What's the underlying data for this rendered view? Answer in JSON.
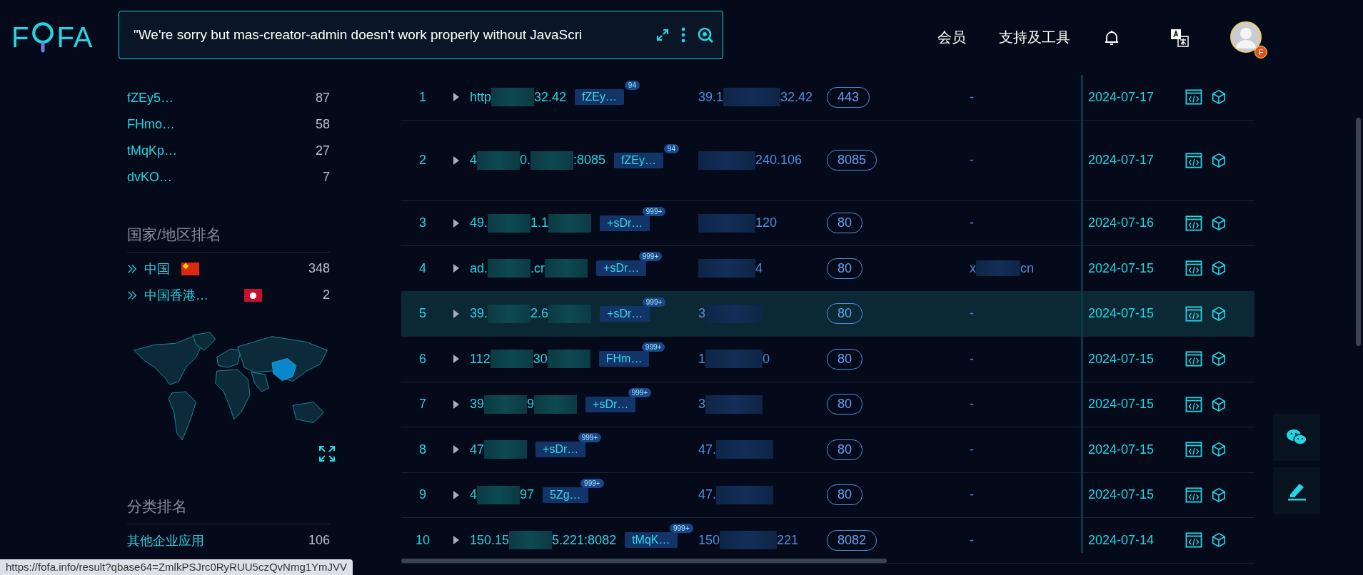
{
  "header": {
    "logo": {
      "before": "F",
      "after": "FA"
    },
    "search": {
      "value": "\"We're sorry but mas-creator-admin doesn't work properly without JavaScri"
    },
    "nav": [
      "会员",
      "支持及工具"
    ],
    "avatar_badge": "F"
  },
  "sidebar": {
    "top_items": [
      {
        "label": "fZEy5…",
        "count": "87"
      },
      {
        "label": "FHmo…",
        "count": "58"
      },
      {
        "label": "tMqKp…",
        "count": "27"
      },
      {
        "label": "dvKO…",
        "count": "7"
      }
    ],
    "country_title": "国家/地区排名",
    "countries": [
      {
        "label": "中国",
        "kind": "cn",
        "count": "348"
      },
      {
        "label": "中国香港…",
        "kind": "hk",
        "count": "2"
      }
    ],
    "category_title": "分类排名",
    "categories": [
      {
        "label": "其他企业应用",
        "count": "106"
      }
    ]
  },
  "rows": [
    {
      "num": "1",
      "host": [
        {
          "kind": "text",
          "text": "http"
        },
        {
          "kind": "blur"
        },
        {
          "kind": "text",
          "text": "32.42"
        }
      ],
      "tag": "fZEy…",
      "tag_count": "94",
      "ip": [
        {
          "kind": "text",
          "text": "39.1"
        },
        {
          "kind": "blur"
        },
        {
          "kind": "text",
          "text": "32.42"
        }
      ],
      "port": "443",
      "domain": [
        {
          "kind": "text",
          "text": "-"
        }
      ],
      "date": "2024-07-17",
      "selected": false,
      "tall": false
    },
    {
      "num": "2",
      "host": [
        {
          "kind": "text",
          "text": "4"
        },
        {
          "kind": "blur"
        },
        {
          "kind": "text",
          "text": "0."
        },
        {
          "kind": "blur"
        },
        {
          "kind": "text",
          "text": ":8085"
        }
      ],
      "tag": "fZEy…",
      "tag_count": "94",
      "ip": [
        {
          "kind": "blur"
        },
        {
          "kind": "text",
          "text": "240.106"
        }
      ],
      "port": "8085",
      "domain": [
        {
          "kind": "text",
          "text": "-"
        }
      ],
      "date": "2024-07-17",
      "selected": false,
      "tall": true
    },
    {
      "num": "3",
      "host": [
        {
          "kind": "text",
          "text": "49."
        },
        {
          "kind": "blur"
        },
        {
          "kind": "text",
          "text": "1.1"
        },
        {
          "kind": "blur"
        }
      ],
      "tag": "+sDr…",
      "tag_count": "999+",
      "ip": [
        {
          "kind": "blur"
        },
        {
          "kind": "text",
          "text": "120"
        }
      ],
      "port": "80",
      "domain": [
        {
          "kind": "text",
          "text": "-"
        }
      ],
      "date": "2024-07-16",
      "selected": false,
      "tall": false
    },
    {
      "num": "4",
      "host": [
        {
          "kind": "text",
          "text": "ad."
        },
        {
          "kind": "blur"
        },
        {
          "kind": "text",
          "text": ".cr"
        },
        {
          "kind": "blur"
        }
      ],
      "tag": "+sDr…",
      "tag_count": "999+",
      "ip": [
        {
          "kind": "blur"
        },
        {
          "kind": "text",
          "text": "4"
        }
      ],
      "port": "80",
      "domain": [
        {
          "kind": "text",
          "text": "x"
        },
        {
          "kind": "blur"
        },
        {
          "kind": "text",
          "text": "cn"
        }
      ],
      "date": "2024-07-15",
      "selected": false,
      "tall": false
    },
    {
      "num": "5",
      "host": [
        {
          "kind": "text",
          "text": "39."
        },
        {
          "kind": "blur"
        },
        {
          "kind": "text",
          "text": "2.6"
        },
        {
          "kind": "blur"
        }
      ],
      "tag": "+sDr…",
      "tag_count": "999+",
      "ip": [
        {
          "kind": "text",
          "text": "3"
        },
        {
          "kind": "blur"
        }
      ],
      "port": "80",
      "domain": [
        {
          "kind": "text",
          "text": "-"
        }
      ],
      "date": "2024-07-15",
      "selected": true,
      "tall": false
    },
    {
      "num": "6",
      "host": [
        {
          "kind": "text",
          "text": "112"
        },
        {
          "kind": "blur"
        },
        {
          "kind": "text",
          "text": "30"
        },
        {
          "kind": "blur"
        }
      ],
      "tag": "FHm…",
      "tag_count": "999+",
      "ip": [
        {
          "kind": "text",
          "text": "1"
        },
        {
          "kind": "blur"
        },
        {
          "kind": "text",
          "text": "0"
        }
      ],
      "port": "80",
      "domain": [
        {
          "kind": "text",
          "text": "-"
        }
      ],
      "date": "2024-07-15",
      "selected": false,
      "tall": false
    },
    {
      "num": "7",
      "host": [
        {
          "kind": "text",
          "text": "39"
        },
        {
          "kind": "blur"
        },
        {
          "kind": "text",
          "text": "9"
        },
        {
          "kind": "blur"
        }
      ],
      "tag": "+sDr…",
      "tag_count": "999+",
      "ip": [
        {
          "kind": "text",
          "text": "3"
        },
        {
          "kind": "blur"
        }
      ],
      "port": "80",
      "domain": [
        {
          "kind": "text",
          "text": "-"
        }
      ],
      "date": "2024-07-15",
      "selected": false,
      "tall": false
    },
    {
      "num": "8",
      "host": [
        {
          "kind": "text",
          "text": "47"
        },
        {
          "kind": "blur"
        }
      ],
      "tag": "+sDr…",
      "tag_count": "999+",
      "ip": [
        {
          "kind": "text",
          "text": "47."
        },
        {
          "kind": "blur"
        }
      ],
      "port": "80",
      "domain": [
        {
          "kind": "text",
          "text": "-"
        }
      ],
      "date": "2024-07-15",
      "selected": false,
      "tall": false
    },
    {
      "num": "9",
      "host": [
        {
          "kind": "text",
          "text": "4"
        },
        {
          "kind": "blur"
        },
        {
          "kind": "text",
          "text": "97"
        }
      ],
      "tag": "5Zg…",
      "tag_count": "999+",
      "ip": [
        {
          "kind": "text",
          "text": "47."
        },
        {
          "kind": "blur"
        }
      ],
      "port": "80",
      "domain": [
        {
          "kind": "text",
          "text": "-"
        }
      ],
      "date": "2024-07-15",
      "selected": false,
      "tall": false
    },
    {
      "num": "10",
      "host": [
        {
          "kind": "text",
          "text": "150.15"
        },
        {
          "kind": "blur"
        },
        {
          "kind": "text",
          "text": "5.221:8082"
        }
      ],
      "tag": "tMqK…",
      "tag_count": "999+",
      "ip": [
        {
          "kind": "text",
          "text": "150"
        },
        {
          "kind": "blur"
        },
        {
          "kind": "text",
          "text": "221"
        }
      ],
      "port": "8082",
      "domain": [
        {
          "kind": "text",
          "text": "-"
        }
      ],
      "date": "2024-07-14",
      "selected": false,
      "tall": false
    }
  ],
  "status_url": "https://fofa.info/result?qbase64=ZmlkPSJrc0RyRUU5czQvNmg1YmJVV"
}
